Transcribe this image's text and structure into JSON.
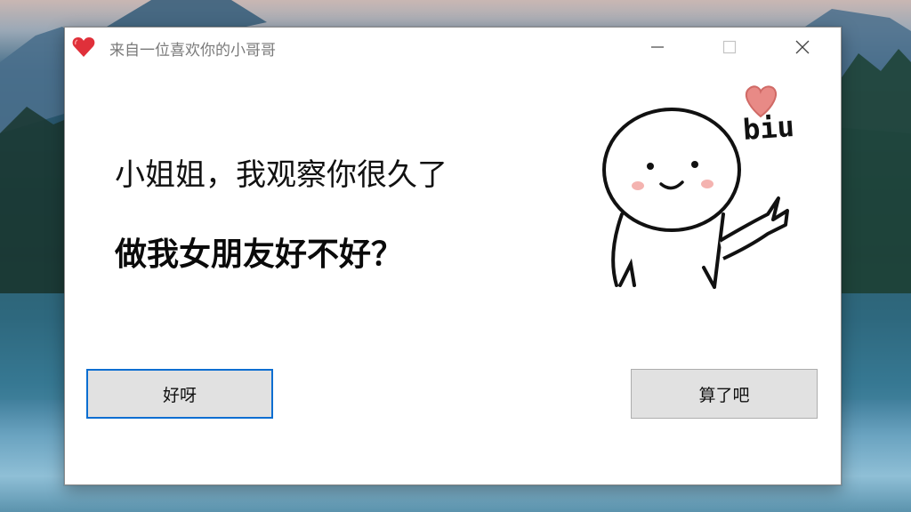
{
  "window": {
    "title": "来自一位喜欢你的小哥哥"
  },
  "icons": {
    "app": "heart-icon",
    "minimize": "minimize-icon",
    "maximize": "maximize-icon",
    "close": "close-icon"
  },
  "content": {
    "line1": "小姐姐，我观察你很久了",
    "line2": "做我女朋友好不好？",
    "sticker_text": "biu"
  },
  "buttons": {
    "yes_label": "好呀",
    "no_label": "算了吧"
  },
  "colors": {
    "focus_border": "#0b6ed1",
    "heart": "#e0303a",
    "sticker_heart": "#e88a86"
  }
}
